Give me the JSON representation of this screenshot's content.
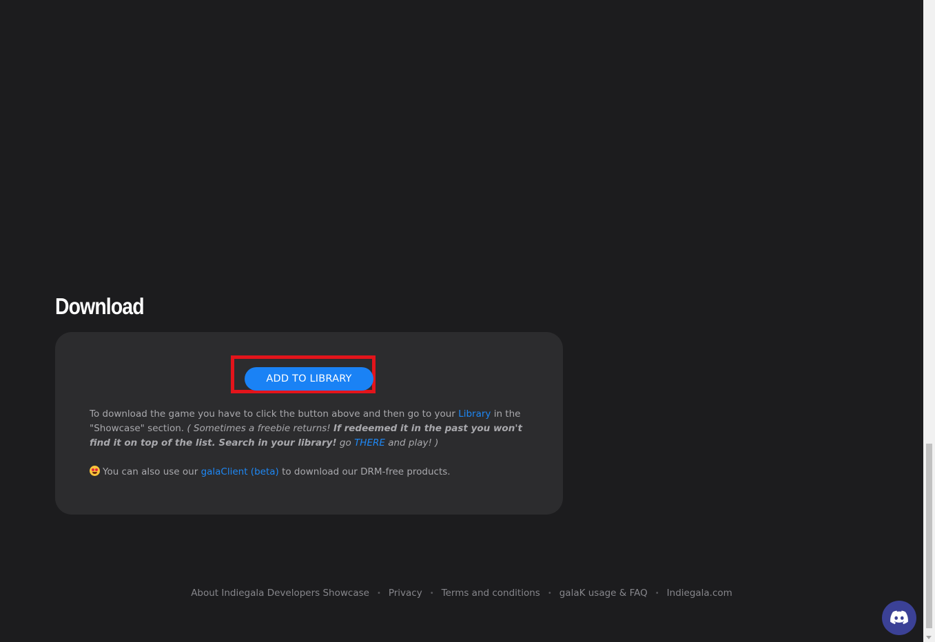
{
  "section": {
    "title": "Download"
  },
  "download": {
    "button_label": "ADD TO LIBRARY",
    "desc_part1": "To download the game you have to click the button above and then go to your ",
    "library_link": "Library",
    "desc_part2": " in the \"Showcase\" section. ",
    "note_open": "( Sometimes a freebie returns! ",
    "note_bold": "If redeemed it in the past you won't find it on top of the list. Search in your library!",
    "note_go": " go ",
    "there_link": "THERE",
    "note_close": " and play! )",
    "client_prefix": "You can also use our ",
    "client_link": "galaClient (beta)",
    "client_suffix": " to download our DRM-free products.",
    "emoji": "star-struck-emoji"
  },
  "footer": {
    "links": [
      "About Indiegala Developers Showcase",
      "Privacy",
      "Terms and conditions",
      "galaK usage & FAQ",
      "Indiegala.com"
    ],
    "separator": "•"
  },
  "colors": {
    "background": "#1c1c1e",
    "card": "#2c2c2e",
    "accent": "#1a82f5",
    "highlight": "#e3141b",
    "discord": "#3b4196"
  },
  "widgets": {
    "discord": "discord-icon"
  }
}
